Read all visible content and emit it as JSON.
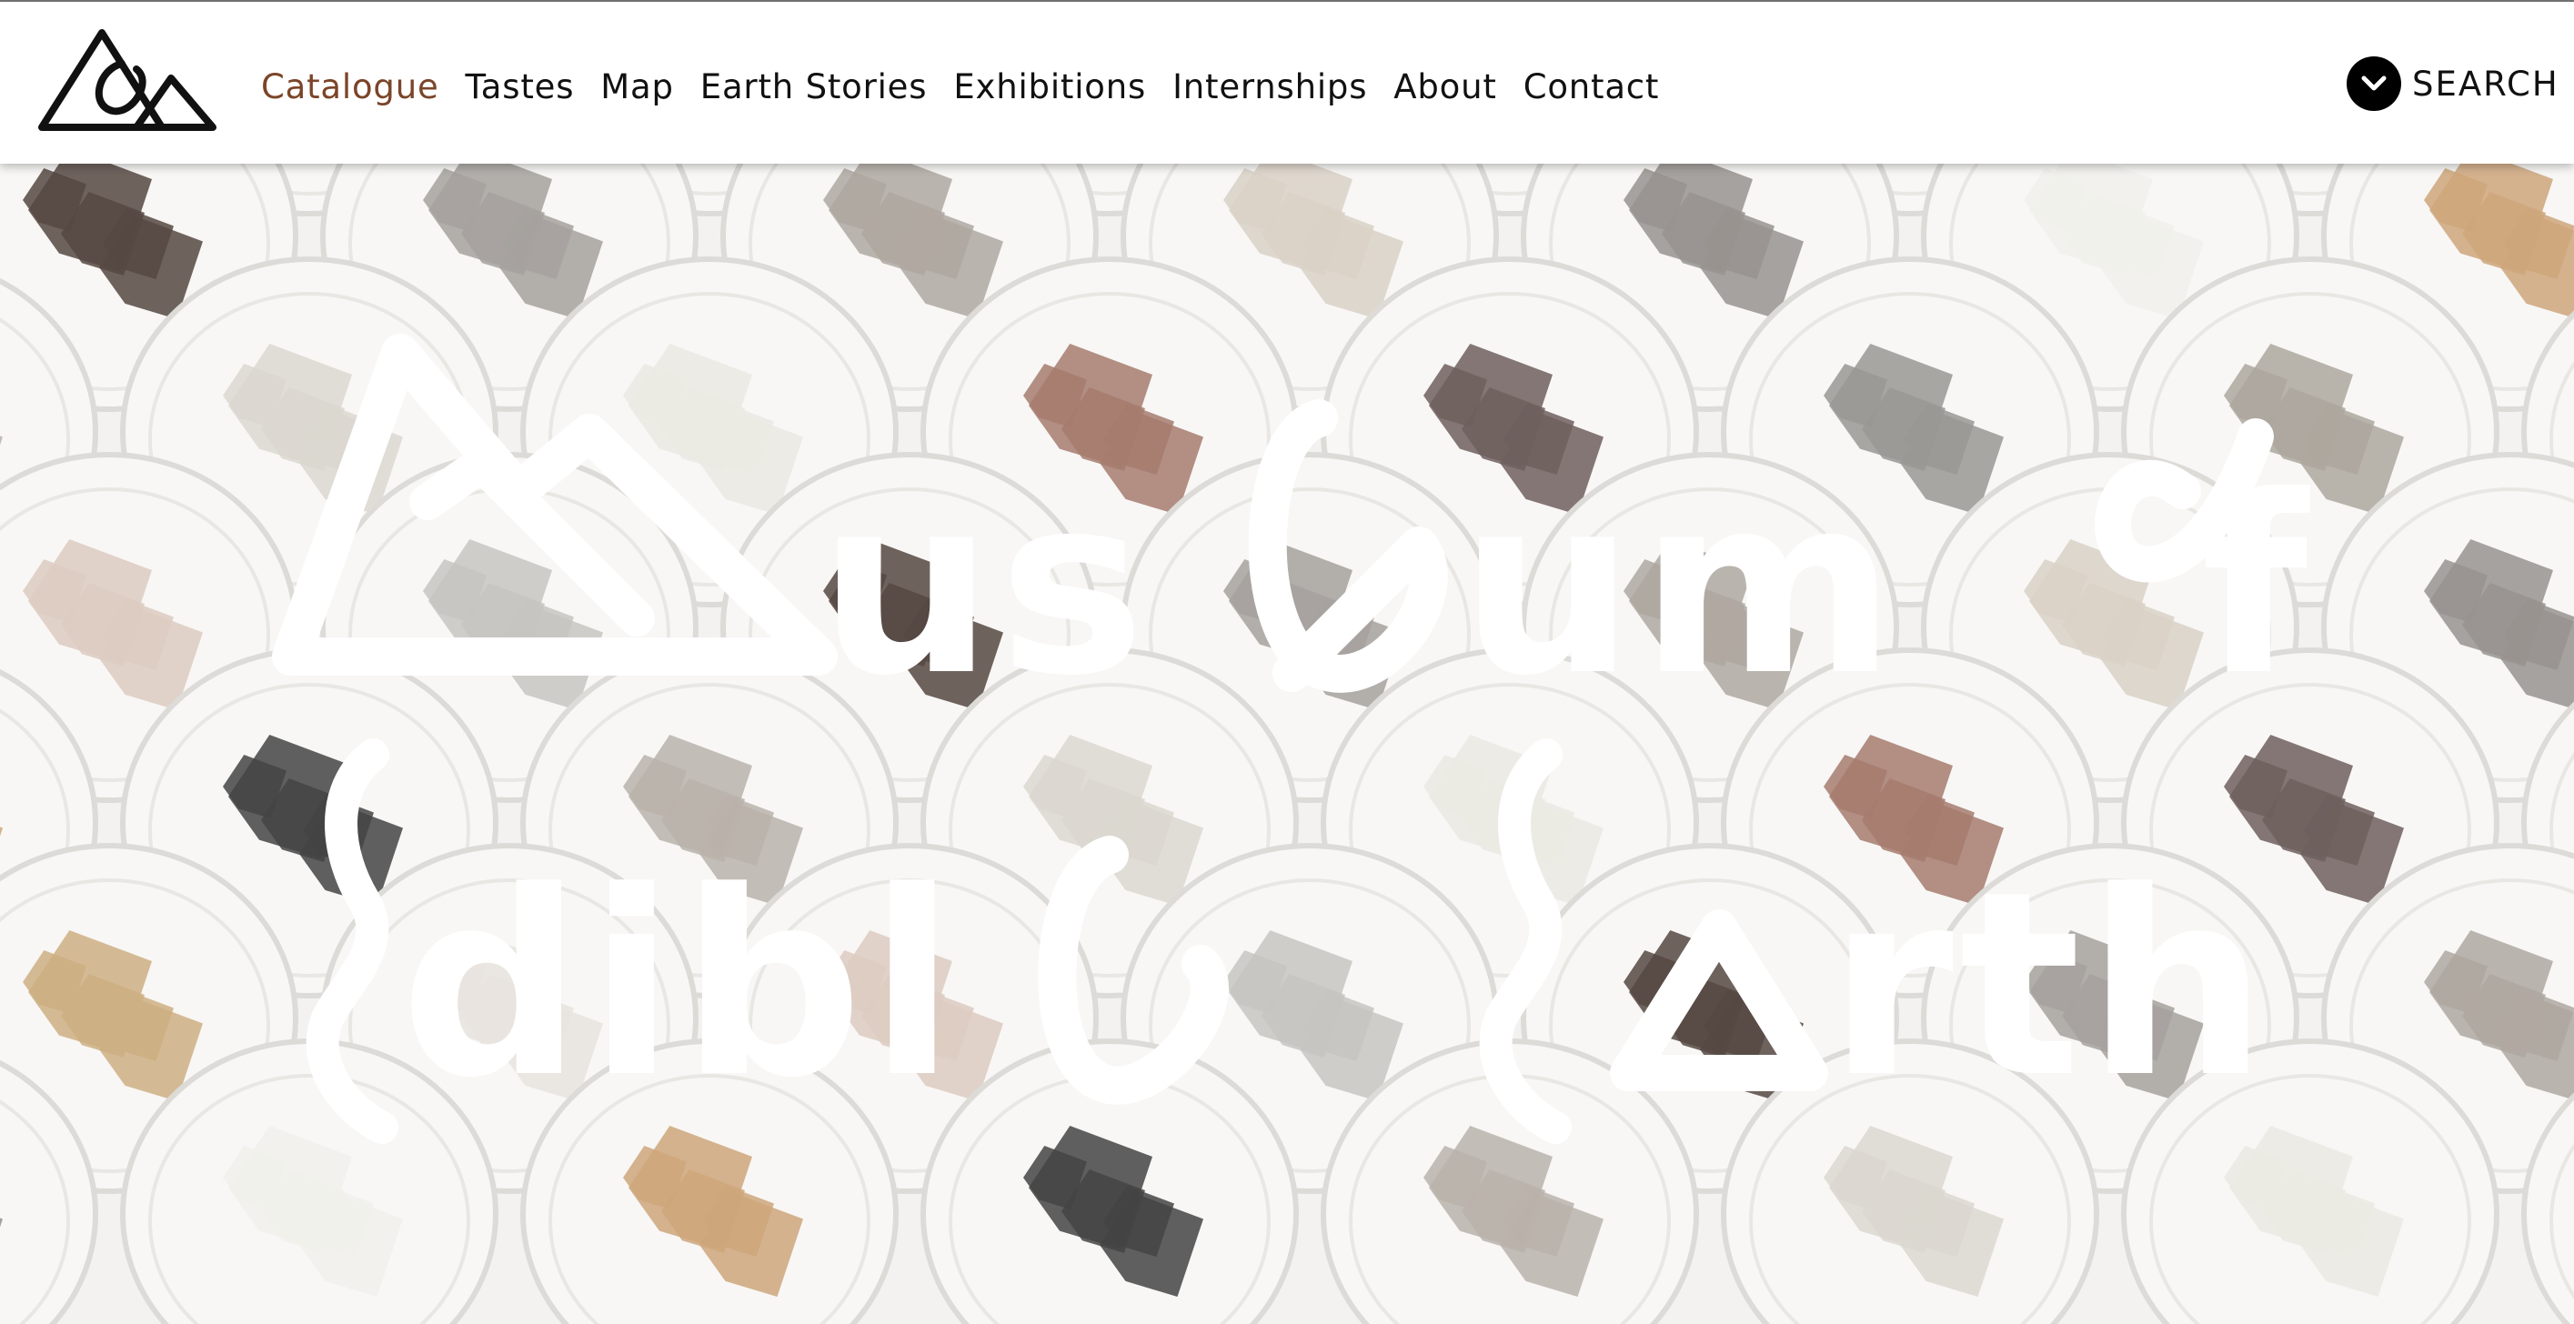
{
  "header": {
    "logo_name": "museum-of-edible-earth-logo",
    "nav": [
      {
        "label": "Catalogue",
        "active": true
      },
      {
        "label": "Tastes",
        "active": false
      },
      {
        "label": "Map",
        "active": false
      },
      {
        "label": "Earth Stories",
        "active": false
      },
      {
        "label": "Exhibitions",
        "active": false
      },
      {
        "label": "Internships",
        "active": false
      },
      {
        "label": "About",
        "active": false
      },
      {
        "label": "Contact",
        "active": false
      }
    ],
    "search_label": "SEARCH",
    "search_icon": "chevron-down-icon"
  },
  "hero": {
    "title_line1": "Museum of",
    "title_line2": "Edible Earth",
    "image_name": "soil-samples-in-petri-dishes-photo"
  },
  "colors": {
    "active_nav": "#7b4529",
    "text": "#111111",
    "header_bg": "#ffffff",
    "title_fill": "#ffffff"
  }
}
